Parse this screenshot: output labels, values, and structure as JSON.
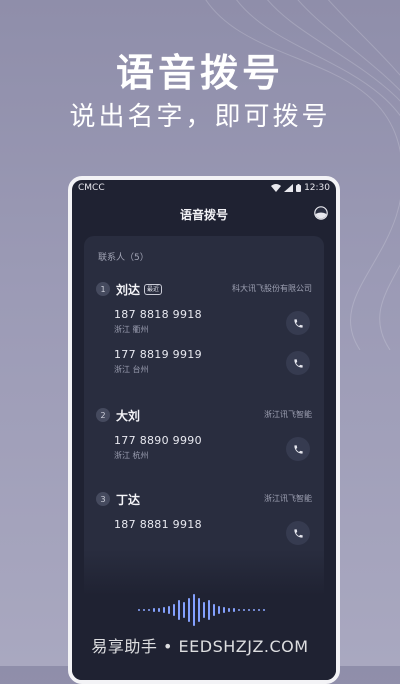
{
  "promo": {
    "headline": "语音拨号",
    "subline": "说出名字，即可拨号"
  },
  "statusbar": {
    "carrier": "CMCC",
    "time": "12:30"
  },
  "app": {
    "title": "语音拨号",
    "section_label": "联系人（5）"
  },
  "contacts": [
    {
      "index": "1",
      "name": "刘达",
      "badge": "最近",
      "company": "科大讯飞股份有限公司",
      "numbers": [
        {
          "number": "187 8818 9918",
          "location": "浙江 衢州"
        },
        {
          "number": "177 8819 9919",
          "location": "浙江 台州"
        }
      ]
    },
    {
      "index": "2",
      "name": "大刘",
      "company": "浙江讯飞智能",
      "numbers": [
        {
          "number": "177 8890 9990",
          "location": "浙江 杭州"
        }
      ]
    },
    {
      "index": "3",
      "name": "丁达",
      "company": "浙江讯飞智能",
      "numbers": [
        {
          "number": "187 8881 9918",
          "location": ""
        }
      ]
    }
  ],
  "watermark": "易享助手 • EEDSHZJZ.COM",
  "colors": {
    "background": "#9c9bb6",
    "phone_bg": "#1f2232",
    "card_bg": "#292d3f",
    "wave_accent": "#3d6bff"
  }
}
